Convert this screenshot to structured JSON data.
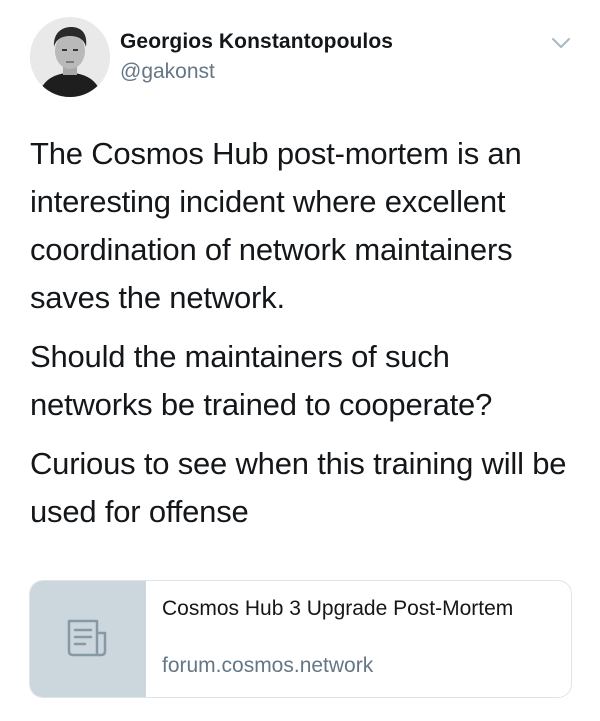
{
  "author": {
    "name": "Georgios Konstantopoulos",
    "handle": "@gakonst",
    "avatar_icon": "profile-photo"
  },
  "menu": {
    "icon": "chevron-down-icon"
  },
  "tweet": {
    "paragraphs": [
      "The Cosmos Hub post-mortem is an interesting incident where excellent coordination of network maintainers saves the network.",
      "Should the maintainers of such networks be trained to cooperate?",
      "Curious to see when this training will be used for offense"
    ]
  },
  "link_card": {
    "title": "Cosmos Hub 3 Upgrade Post-Mortem",
    "domain": "forum.cosmos.network",
    "thumbnail_icon": "document-icon"
  },
  "colors": {
    "text_primary": "#14171a",
    "text_secondary": "#657786",
    "card_border": "#dfe4e8",
    "card_thumb_bg": "#ccd6dd",
    "icon_gray": "#8899a6"
  }
}
